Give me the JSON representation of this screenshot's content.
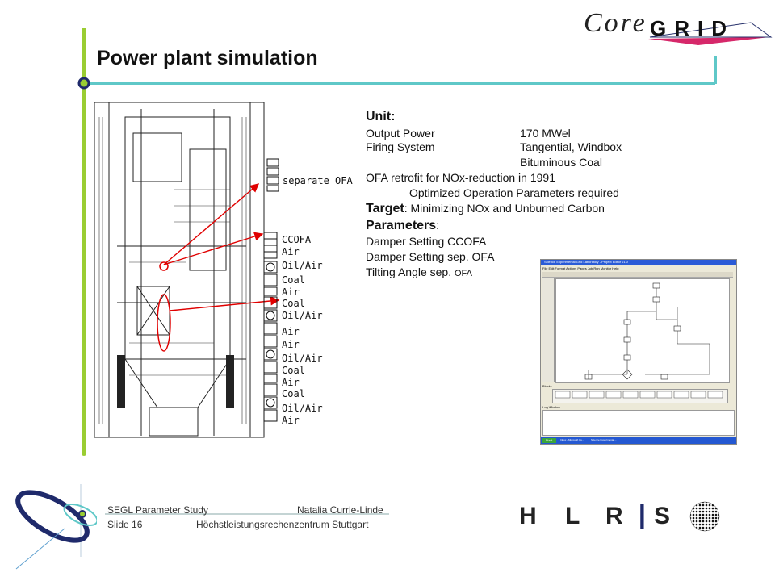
{
  "slide": {
    "title": "Power plant simulation",
    "logo_core": "Core",
    "logo_grid": "GRID",
    "hlrs_letters": [
      "H",
      "L",
      "R",
      "I",
      "S"
    ]
  },
  "unit_section": {
    "heading": "Unit:",
    "rows": [
      {
        "label": "Output Power",
        "value": "170 MWel"
      },
      {
        "label": "Firing System",
        "value": "Tangential, Windbox"
      },
      {
        "label": "",
        "value": "Bituminous Coal"
      }
    ],
    "retrofit": "OFA retrofit for NOx-reduction in 1991",
    "retrofit_detail": "Optimized Operation Parameters required"
  },
  "target": {
    "heading": "Target",
    "text": ": Minimizing NOx and Unburned Carbon"
  },
  "parameters": {
    "heading": "Parameters",
    "colon": ":",
    "items": [
      "Damper Setting CCOFA",
      "Damper Setting sep. OFA",
      "Tilting Angle sep. "
    ],
    "last_suffix": "OFA"
  },
  "diagram": {
    "separate_label": "separate OFA",
    "burner_labels": [
      "CCOFA",
      "Air",
      "Oil/Air",
      "Coal",
      "Air",
      "Coal",
      "Oil/Air",
      "Air",
      "Air",
      "Oil/Air",
      "Coal",
      "Air",
      "Coal",
      "Oil/Air",
      "Air"
    ]
  },
  "screenshot": {
    "window_title": "Science Experimental Grid Laboratory - Project Editor v1.0",
    "menu": "File  Edit  Format  Actions  Pages  Job  Run  Monitor  Help",
    "nodes": [
      "create",
      "generation",
      "simulation",
      "calculation",
      "evaluation",
      "terminate",
      "condition",
      "recombination",
      "sampling"
    ],
    "toolbox_label": "Blocks",
    "toolbox_items": [
      "GENERATE",
      "TERMINATE",
      "BLOCK",
      "BRANCH",
      "CONDITION",
      "MESSAGE",
      "WAIT EVAL",
      "WAIT EVENT",
      "PARALLELIZE",
      "COLLECT"
    ],
    "log_label": "Log Window",
    "start_label": "Start",
    "tasks": [
      "Inbox - Microsoft Ou...",
      "Science Experimental..."
    ]
  },
  "footer": {
    "left_top": "SEGL Parameter  Study",
    "left_bottom": "Slide 16",
    "right_top": "Natalia Currle-Linde",
    "right_bottom": "Höchstleistungsrechenzentrum  Stuttgart"
  },
  "colors": {
    "accent_green": "#9acd32",
    "accent_teal": "#5fc8c8",
    "navy": "#1f2a6b",
    "arrow_red": "#e00000"
  }
}
